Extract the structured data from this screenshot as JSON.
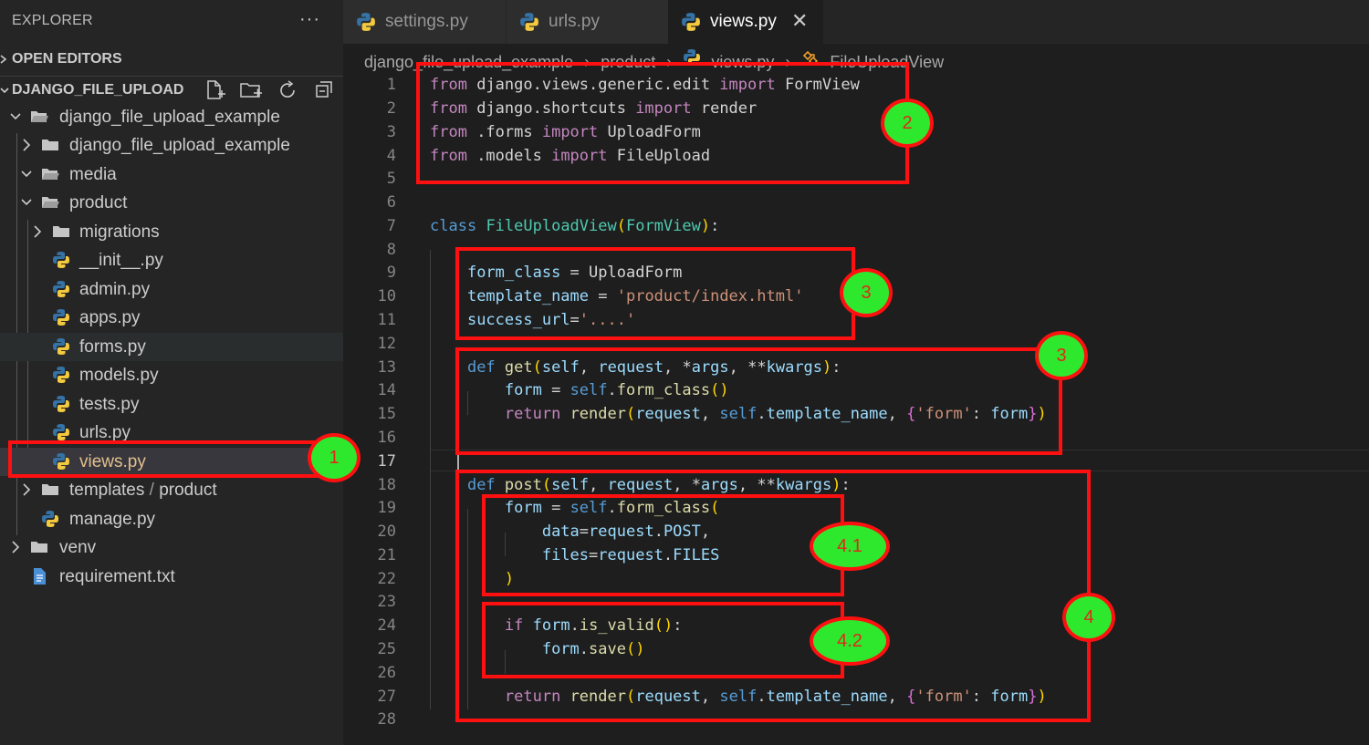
{
  "explorer": {
    "title": "EXPLORER",
    "more": "···",
    "open_editors": "OPEN EDITORS",
    "project": "DJANGO_FILE_UPLOAD",
    "tree": [
      "django_file_upload_example",
      "django_file_upload_example",
      "media",
      "product",
      "migrations",
      "__init__.py",
      "admin.py",
      "apps.py",
      "forms.py",
      "models.py",
      "tests.py",
      "urls.py",
      "views.py",
      "templates",
      "manage.py",
      "venv",
      "requirement.txt"
    ],
    "templates_suffix_sep": " / ",
    "templates_suffix": "product"
  },
  "tabs": [
    {
      "label": "settings.py"
    },
    {
      "label": "urls.py"
    },
    {
      "label": "views.py",
      "close": "✕"
    }
  ],
  "breadcrumb": {
    "parts": [
      "django_file_upload_example",
      "product",
      "views.py",
      "FileUploadView"
    ],
    "sep": "›"
  },
  "editor": {
    "line_numbers": [
      "1",
      "2",
      "3",
      "4",
      "5",
      "6",
      "7",
      "8",
      "9",
      "10",
      "11",
      "12",
      "13",
      "14",
      "15",
      "16",
      "17",
      "18",
      "19",
      "20",
      "21",
      "22",
      "23",
      "24",
      "25",
      "26",
      "27",
      "28"
    ],
    "current_line": "17"
  },
  "annotations": {
    "badges": [
      "1",
      "2",
      "3",
      "3",
      "4.1",
      "4.2",
      "4"
    ],
    "box_color": "#ff1010",
    "badge_color": "#2ee82e"
  },
  "colors": {
    "keyword": "#c586c0",
    "storage": "#569cd6",
    "function": "#dcdcaa",
    "class": "#4ec9b0",
    "variable": "#9cdcfe",
    "string": "#ce9178"
  },
  "icons": {
    "python": "python-icon",
    "folder": "folder-icon",
    "file": "text-file-icon",
    "chevron": "chevron-icon",
    "class": "class-symbol-icon"
  }
}
